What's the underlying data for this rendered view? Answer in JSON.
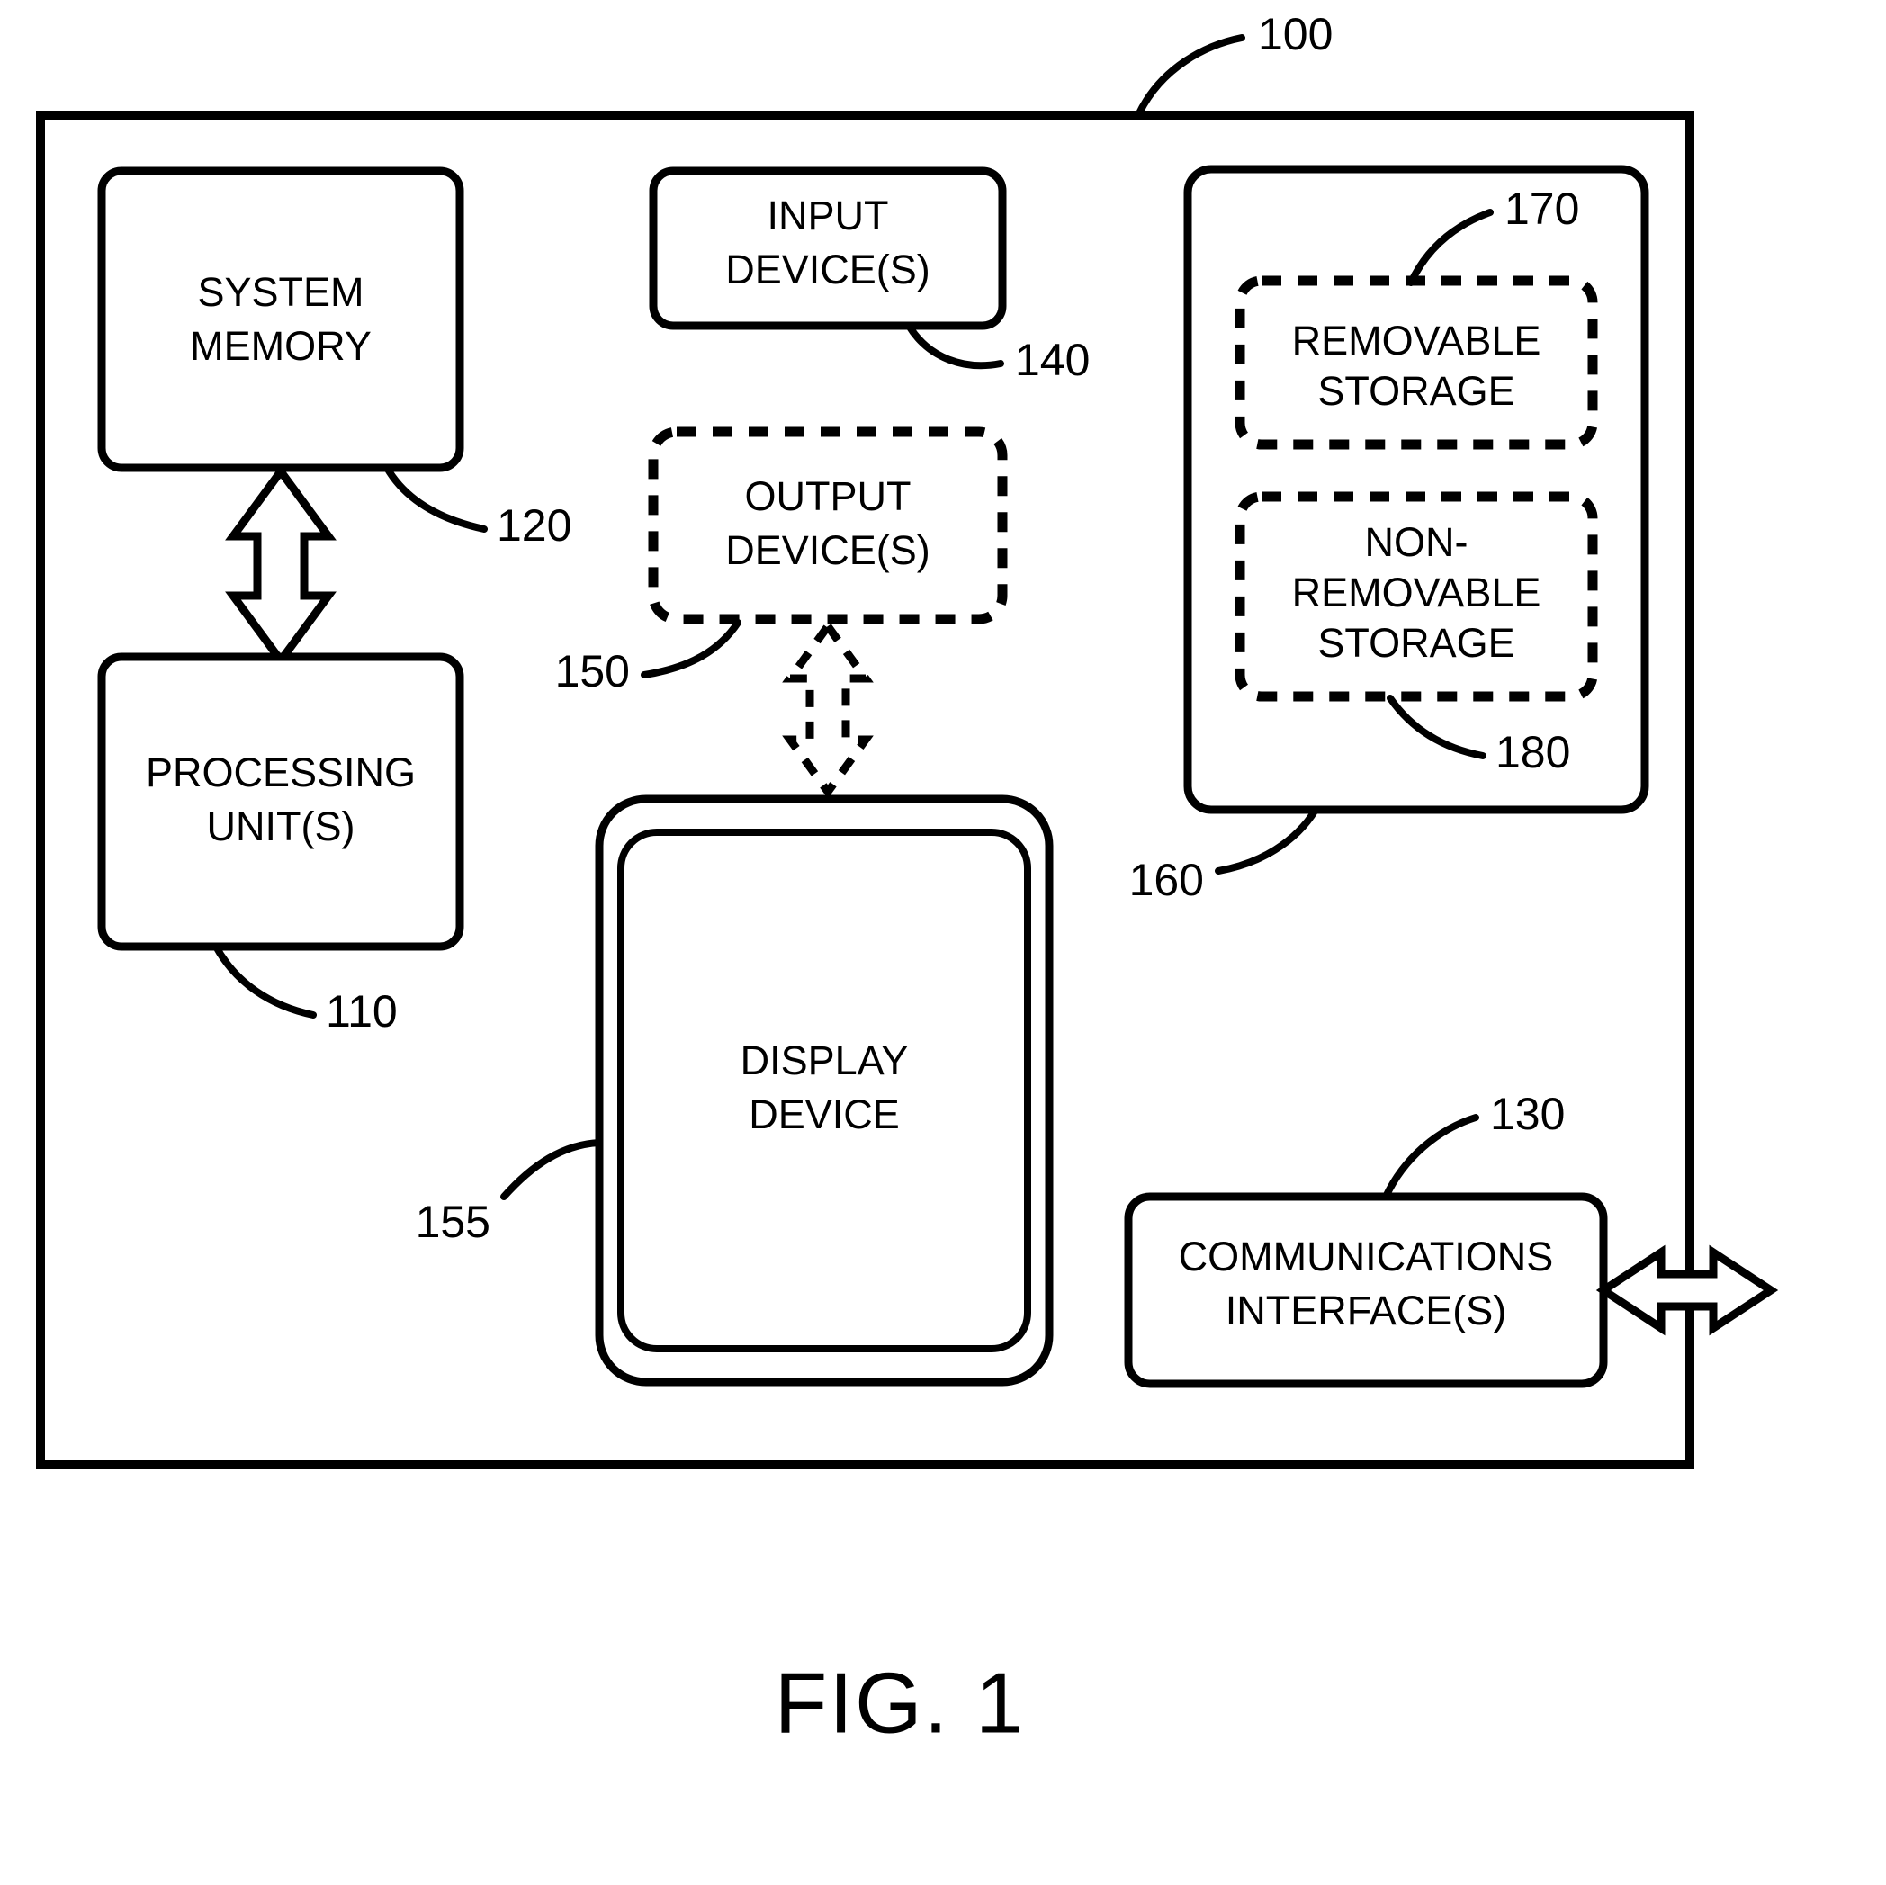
{
  "figure": {
    "caption": "FIG. 1",
    "system_ref": "100"
  },
  "blocks": {
    "system_memory": {
      "label_line1": "SYSTEM",
      "label_line2": "MEMORY",
      "ref": "120"
    },
    "processing_unit": {
      "label_line1": "PROCESSING",
      "label_line2": "UNIT(S)",
      "ref": "110"
    },
    "input_devices": {
      "label_line1": "INPUT",
      "label_line2": "DEVICE(S)",
      "ref": "140"
    },
    "output_devices": {
      "label_line1": "OUTPUT",
      "label_line2": "DEVICE(S)",
      "ref": "150"
    },
    "display_device": {
      "label_line1": "DISPLAY",
      "label_line2": "DEVICE",
      "ref": "155"
    },
    "storage_container": {
      "ref": "160"
    },
    "removable_storage": {
      "label_line1": "REMOVABLE",
      "label_line2": "STORAGE",
      "ref": "170"
    },
    "non_removable_storage": {
      "label_line1": "NON-",
      "label_line2": "REMOVABLE",
      "label_line3": "STORAGE",
      "ref": "180"
    },
    "communications_interface": {
      "label_line1": "COMMUNICATIONS",
      "label_line2": "INTERFACE(S)",
      "ref": "130"
    }
  },
  "colors": {
    "ink": "#000000",
    "paper": "#ffffff"
  }
}
